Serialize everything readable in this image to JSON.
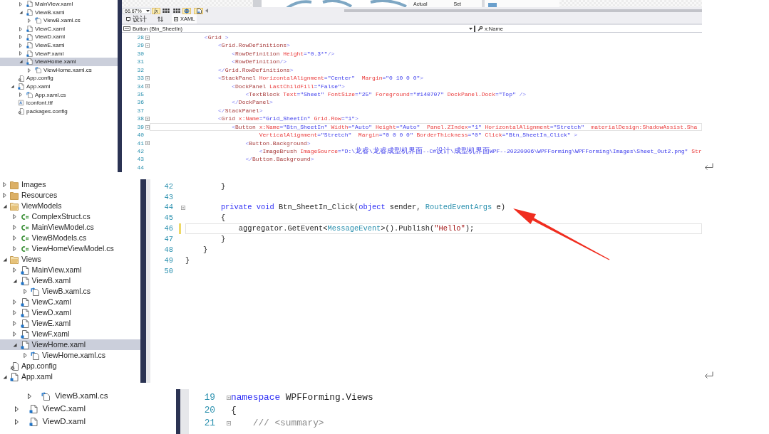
{
  "captures": [
    {
      "explorer": {
        "items": [
          {
            "children": [
              {
                "label": "MainView.xaml",
                "kind": "xaml",
                "expanded": false,
                "selected": false
              },
              {
                "label": "ViewB.xaml",
                "kind": "xaml",
                "expanded": true,
                "selected": false,
                "children": [
                  {
                    "label": "ViewB.xaml.cs",
                    "kind": "code-behind",
                    "expanded": false,
                    "selected": false
                  }
                ]
              },
              {
                "label": "ViewC.xaml",
                "kind": "xaml",
                "expanded": false,
                "selected": false
              },
              {
                "label": "ViewD.xaml",
                "kind": "xaml",
                "expanded": false,
                "selected": false
              },
              {
                "label": "ViewE.xaml",
                "kind": "xaml",
                "expanded": false,
                "selected": false
              },
              {
                "label": "ViewF.xaml",
                "kind": "xaml",
                "expanded": false,
                "selected": false
              },
              {
                "label": "ViewHome.xaml",
                "kind": "xaml",
                "expanded": true,
                "selected": true,
                "children": [
                  {
                    "label": "ViewHome.xaml.cs",
                    "kind": "code-behind",
                    "expanded": false,
                    "selected": false
                  }
                ]
              }
            ]
          },
          {
            "label": "App.config",
            "kind": "config",
            "selected": false
          },
          {
            "label": "App.xaml",
            "kind": "xaml",
            "expanded": true,
            "selected": false,
            "children": [
              {
                "label": "App.xaml.cs",
                "kind": "code-behind",
                "expanded": false,
                "selected": false
              }
            ]
          },
          {
            "label": "iconfont.ttf",
            "kind": "font",
            "selected": false
          },
          {
            "label": "packages.config",
            "kind": "config",
            "selected": false
          }
        ]
      },
      "designer": {
        "preview_labels": [
          "Actual",
          "Set"
        ]
      },
      "toolbar": {
        "zoom": "66.67%",
        "formula_button": "fx"
      },
      "tabs": [
        {
          "label": "设计",
          "kind": "design",
          "selected": false
        },
        {
          "label": "XAML",
          "kind": "xaml",
          "selected": true
        }
      ],
      "navigation": {
        "element": "Button (Btn_SheetIn)",
        "member": "x:Name"
      },
      "editor": {
        "lines": [
          {
            "number": "28",
            "current": false,
            "foldable": true,
            "tokens": [
              {
                "kind": "bracket",
                "text": "                <"
              },
              {
                "kind": "element",
                "text": "Grid"
              },
              {
                "kind": "bracket",
                "text": " >"
              }
            ]
          },
          {
            "number": "29",
            "current": false,
            "foldable": true,
            "tokens": [
              {
                "kind": "bracket",
                "text": "                    <"
              },
              {
                "kind": "element",
                "text": "Grid.RowDefinitions"
              },
              {
                "kind": "bracket",
                "text": ">"
              }
            ]
          },
          {
            "number": "30",
            "current": false,
            "foldable": false,
            "tokens": [
              {
                "kind": "bracket",
                "text": "                        <"
              },
              {
                "kind": "element",
                "text": "RowDefinition"
              },
              {
                "kind": "attribute",
                "text": " Height"
              },
              {
                "kind": "value",
                "text": "=\"0.3*\""
              },
              {
                "kind": "bracket",
                "text": "/>"
              }
            ]
          },
          {
            "number": "31",
            "current": false,
            "foldable": false,
            "tokens": [
              {
                "kind": "bracket",
                "text": "                        <"
              },
              {
                "kind": "element",
                "text": "RowDefinition"
              },
              {
                "kind": "bracket",
                "text": "/>"
              }
            ]
          },
          {
            "number": "32",
            "current": false,
            "foldable": false,
            "tokens": [
              {
                "kind": "bracket",
                "text": "                    </"
              },
              {
                "kind": "element",
                "text": "Grid.RowDefinitions"
              },
              {
                "kind": "bracket",
                "text": ">"
              }
            ]
          },
          {
            "number": "33",
            "current": false,
            "foldable": true,
            "tokens": [
              {
                "kind": "bracket",
                "text": "                    <"
              },
              {
                "kind": "element",
                "text": "StackPanel"
              },
              {
                "kind": "attribute",
                "text": " HorizontalAlignment"
              },
              {
                "kind": "value",
                "text": "=\"Center\""
              },
              {
                "kind": "attribute",
                "text": "  Margin"
              },
              {
                "kind": "value",
                "text": "=\"0 10 0 0\""
              },
              {
                "kind": "bracket",
                "text": ">"
              }
            ]
          },
          {
            "number": "34",
            "current": false,
            "foldable": true,
            "tokens": [
              {
                "kind": "bracket",
                "text": "                        <"
              },
              {
                "kind": "element",
                "text": "DockPanel"
              },
              {
                "kind": "attribute",
                "text": " LastChildFill"
              },
              {
                "kind": "value",
                "text": "=\"False\""
              },
              {
                "kind": "bracket",
                "text": ">"
              }
            ]
          },
          {
            "number": "35",
            "current": false,
            "foldable": false,
            "tokens": [
              {
                "kind": "bracket",
                "text": "                            <"
              },
              {
                "kind": "element",
                "text": "TextBlock"
              },
              {
                "kind": "attribute",
                "text": " Text"
              },
              {
                "kind": "value",
                "text": "=\"Sheet\""
              },
              {
                "kind": "attribute",
                "text": " FontSize"
              },
              {
                "kind": "value",
                "text": "=\"25\""
              },
              {
                "kind": "attribute",
                "text": " Foreground"
              },
              {
                "kind": "value",
                "text": "=\"#140707\""
              },
              {
                "kind": "attribute",
                "text": " DockPanel.Dock"
              },
              {
                "kind": "value",
                "text": "=\"Top\""
              },
              {
                "kind": "bracket",
                "text": " />"
              }
            ]
          },
          {
            "number": "36",
            "current": false,
            "foldable": false,
            "tokens": [
              {
                "kind": "bracket",
                "text": "                        </"
              },
              {
                "kind": "element",
                "text": "DockPanel"
              },
              {
                "kind": "bracket",
                "text": ">"
              }
            ]
          },
          {
            "number": "37",
            "current": false,
            "foldable": false,
            "tokens": [
              {
                "kind": "bracket",
                "text": "                    </"
              },
              {
                "kind": "element",
                "text": "StackPanel"
              },
              {
                "kind": "bracket",
                "text": ">"
              }
            ]
          },
          {
            "number": "38",
            "current": false,
            "foldable": true,
            "tokens": [
              {
                "kind": "bracket",
                "text": "                    <"
              },
              {
                "kind": "element",
                "text": "Grid"
              },
              {
                "kind": "attribute",
                "text": " x:Name"
              },
              {
                "kind": "value",
                "text": "=\"Grid_SheetIn\""
              },
              {
                "kind": "attribute",
                "text": " Grid.Row"
              },
              {
                "kind": "value",
                "text": "=\"1\""
              },
              {
                "kind": "bracket",
                "text": ">"
              }
            ]
          },
          {
            "number": "39",
            "current": true,
            "foldable": true,
            "tokens": [
              {
                "kind": "bracket",
                "text": "                        <"
              },
              {
                "kind": "element",
                "text": "Button"
              },
              {
                "kind": "attribute",
                "text": " x:Name"
              },
              {
                "kind": "value",
                "text": "=\"Btn_SheetIn\""
              },
              {
                "kind": "attribute",
                "text": " Width"
              },
              {
                "kind": "value",
                "text": "=\"Auto\""
              },
              {
                "kind": "attribute",
                "text": " Height"
              },
              {
                "kind": "value",
                "text": "=\"Auto\""
              },
              {
                "kind": "attribute",
                "text": "  Panel.ZIndex"
              },
              {
                "kind": "value",
                "text": "=\"1\""
              },
              {
                "kind": "attribute",
                "text": " HorizontalAlignment"
              },
              {
                "kind": "value",
                "text": "=\"Stretch\""
              },
              {
                "kind": "attribute",
                "text": "  materialDesign:ShadowAssist.Sha"
              }
            ]
          },
          {
            "number": "40",
            "current": false,
            "foldable": false,
            "tokens": [
              {
                "kind": "attribute",
                "text": "                                VerticalAlignment"
              },
              {
                "kind": "value",
                "text": "=\"Stretch\""
              },
              {
                "kind": "attribute",
                "text": "  Margin"
              },
              {
                "kind": "value",
                "text": "=\"0 0 0 0\""
              },
              {
                "kind": "attribute",
                "text": " BorderThickness"
              },
              {
                "kind": "value",
                "text": "=\"0\""
              },
              {
                "kind": "attribute",
                "text": " Click"
              },
              {
                "kind": "value",
                "text": "=\"Btn_SheetIn_Click\""
              },
              {
                "kind": "bracket",
                "text": " >"
              }
            ]
          },
          {
            "number": "41",
            "current": false,
            "foldable": true,
            "tokens": [
              {
                "kind": "bracket",
                "text": "                            <"
              },
              {
                "kind": "element",
                "text": "Button.Background"
              },
              {
                "kind": "bracket",
                "text": ">"
              }
            ]
          },
          {
            "number": "42",
            "current": false,
            "foldable": false,
            "tokens": [
              {
                "kind": "bracket",
                "text": "                                <"
              },
              {
                "kind": "element",
                "text": "ImageBrush"
              },
              {
                "kind": "attribute",
                "text": " ImageSource"
              },
              {
                "kind": "value",
                "text": "=\"D:\\龙睿\\龙睿成型机界面--C#设计\\成型机界面WPF--20220906\\WPFForming\\WPFForming\\Images\\Sheet_Out2.png\""
              },
              {
                "kind": "attribute",
                "text": " Str"
              }
            ]
          },
          {
            "number": "43",
            "current": false,
            "foldable": false,
            "tokens": [
              {
                "kind": "bracket",
                "text": "                            </"
              },
              {
                "kind": "element",
                "text": "Button.Background"
              },
              {
                "kind": "bracket",
                "text": ">"
              }
            ]
          },
          {
            "number": "44",
            "current": false,
            "foldable": false
          }
        ]
      }
    },
    {
      "explorer": {
        "items": [
          {
            "label": "Images",
            "kind": "folder",
            "expanded": false,
            "selected": false
          },
          {
            "label": "Resources",
            "kind": "folder",
            "expanded": false,
            "selected": false
          },
          {
            "label": "ViewModels",
            "kind": "folder",
            "expanded": true,
            "selected": false,
            "children": [
              {
                "label": "ComplexStruct.cs",
                "kind": "class",
                "expanded": false,
                "selected": false
              },
              {
                "label": "MainViewModel.cs",
                "kind": "class",
                "expanded": false,
                "selected": false
              },
              {
                "label": "ViewBModels.cs",
                "kind": "class",
                "expanded": false,
                "selected": false
              },
              {
                "label": "ViewHomeViewModel.cs",
                "kind": "class",
                "expanded": false,
                "selected": false
              }
            ]
          },
          {
            "label": "Views",
            "kind": "folder",
            "expanded": true,
            "selected": false,
            "children": [
              {
                "label": "MainView.xaml",
                "kind": "xaml",
                "expanded": false,
                "selected": false
              },
              {
                "label": "ViewB.xaml",
                "kind": "xaml",
                "expanded": true,
                "selected": false,
                "children": [
                  {
                    "label": "ViewB.xaml.cs",
                    "kind": "code-behind",
                    "expanded": false,
                    "selected": false
                  }
                ]
              },
              {
                "label": "ViewC.xaml",
                "kind": "xaml",
                "expanded": false,
                "selected": false
              },
              {
                "label": "ViewD.xaml",
                "kind": "xaml",
                "expanded": false,
                "selected": false
              },
              {
                "label": "ViewE.xaml",
                "kind": "xaml",
                "expanded": false,
                "selected": false
              },
              {
                "label": "ViewF.xaml",
                "kind": "xaml",
                "expanded": false,
                "selected": false
              },
              {
                "label": "ViewHome.xaml",
                "kind": "xaml",
                "expanded": true,
                "selected": true,
                "children": [
                  {
                    "label": "ViewHome.xaml.cs",
                    "kind": "code-behind",
                    "expanded": false,
                    "selected": false
                  }
                ]
              }
            ]
          },
          {
            "label": "App.config",
            "kind": "config",
            "selected": false
          },
          {
            "label": "App.xaml",
            "kind": "xaml",
            "expanded": true,
            "selected": false
          }
        ]
      },
      "editor": {
        "lines": [
          {
            "number": "42",
            "current": false,
            "modified": false,
            "foldable": false,
            "tokens": [
              {
                "kind": "plain",
                "text": "        }"
              }
            ]
          },
          {
            "number": "43",
            "current": false,
            "modified": false,
            "foldable": false
          },
          {
            "number": "44",
            "current": false,
            "modified": false,
            "foldable": true,
            "tokens": [
              {
                "kind": "keyword",
                "text": "        private"
              },
              {
                "kind": "keyword",
                "text": " void"
              },
              {
                "kind": "plain",
                "text": " Btn_SheetIn_Click("
              },
              {
                "kind": "keyword",
                "text": "object"
              },
              {
                "kind": "plain",
                "text": " sender, "
              },
              {
                "kind": "type",
                "text": "RoutedEventArgs"
              },
              {
                "kind": "plain",
                "text": " e)"
              }
            ]
          },
          {
            "number": "45",
            "current": false,
            "modified": false,
            "foldable": false,
            "tokens": [
              {
                "kind": "plain",
                "text": "        {"
              }
            ]
          },
          {
            "number": "46",
            "current": true,
            "modified": true,
            "foldable": false,
            "tokens": [
              {
                "kind": "plain",
                "text": "            aggregator.GetEvent<"
              },
              {
                "kind": "type",
                "text": "MessageEvent"
              },
              {
                "kind": "plain",
                "text": ">().Publish("
              },
              {
                "kind": "string",
                "text": "\"Hello\""
              },
              {
                "kind": "plain",
                "text": ");"
              }
            ]
          },
          {
            "number": "47",
            "current": false,
            "modified": false,
            "foldable": false,
            "tokens": [
              {
                "kind": "plain",
                "text": "        }"
              }
            ]
          },
          {
            "number": "48",
            "current": false,
            "modified": false,
            "foldable": false,
            "tokens": [
              {
                "kind": "plain",
                "text": "    }"
              }
            ]
          },
          {
            "number": "49",
            "current": false,
            "modified": false,
            "foldable": false,
            "tokens": [
              {
                "kind": "plain",
                "text": "}"
              }
            ]
          },
          {
            "number": "50",
            "current": false,
            "modified": false,
            "foldable": false
          }
        ]
      }
    },
    {
      "explorer": {
        "items": [
          {
            "children": [
              {
                "children": [
                  {
                    "label": "ViewB.xaml.cs",
                    "kind": "code-behind",
                    "expanded": false,
                    "selected": false
                  }
                ]
              },
              {
                "label": "ViewC.xaml",
                "kind": "xaml",
                "expanded": false,
                "selected": false
              },
              {
                "label": "ViewD.xaml",
                "kind": "xaml",
                "expanded": false,
                "selected": false
              }
            ]
          }
        ]
      },
      "editor": {
        "lines": [
          {
            "number": "19",
            "foldable": true,
            "tokens": [
              {
                "kind": "keyword",
                "text": "namespace"
              },
              {
                "kind": "plain",
                "text": " WPFForming.Views"
              }
            ]
          },
          {
            "number": "20",
            "foldable": false,
            "tokens": [
              {
                "kind": "plain",
                "text": "{"
              }
            ]
          },
          {
            "number": "21",
            "foldable": true,
            "tokens": [
              {
                "kind": "comment",
                "text": "    /// <summary>"
              }
            ]
          }
        ]
      }
    }
  ]
}
